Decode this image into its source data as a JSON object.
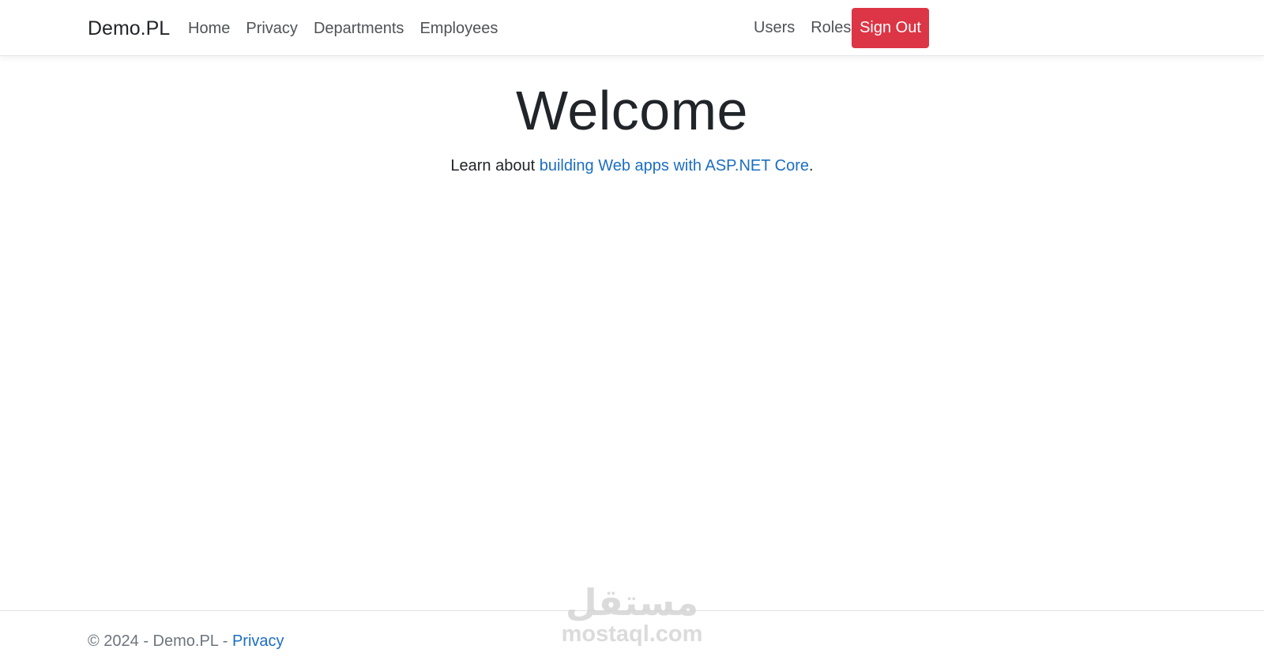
{
  "nav": {
    "brand": "Demo.PL",
    "left_links": [
      "Home",
      "Privacy",
      "Departments",
      "Employees"
    ],
    "right_links": [
      "Users",
      "Roles"
    ],
    "signout_label": "Sign Out",
    "signout_color": "#dc3545"
  },
  "main": {
    "heading": "Welcome",
    "lead_prefix": "Learn about ",
    "lead_link": "building Web apps with ASP.NET Core",
    "lead_suffix": "."
  },
  "footer": {
    "copyright": "© 2024 - Demo.PL - ",
    "privacy_link": "Privacy"
  },
  "watermark": {
    "mark": "مستقل",
    "domain": "mostaql.com"
  },
  "colors": {
    "link": "#1b6ec2",
    "danger": "#dc3545"
  }
}
